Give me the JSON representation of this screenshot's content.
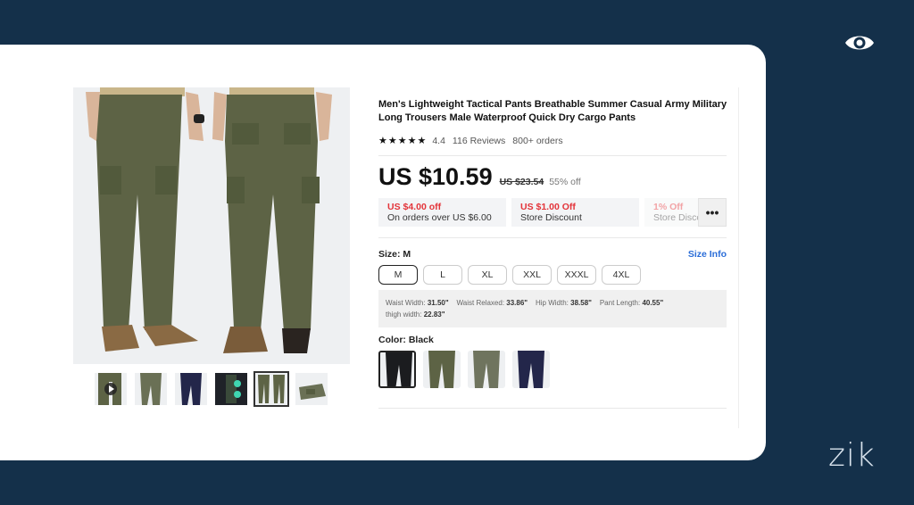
{
  "product": {
    "title": "Men's Lightweight Tactical Pants Breathable Summer Casual Army Military Long Trousers Male Waterproof Quick Dry Cargo Pants",
    "rating": "4.4",
    "reviews": "116 Reviews",
    "orders": "800+ orders",
    "price": "US $10.59",
    "old_price": "US $23.54",
    "discount": "55% off"
  },
  "coupons": [
    {
      "amount": "US $4.00 off",
      "desc": "On orders over US $6.00"
    },
    {
      "amount": "US $1.00 Off",
      "desc": "Store Discount"
    },
    {
      "amount": "1% Off",
      "desc": "Store Discount"
    }
  ],
  "more_label": "•••",
  "size": {
    "label": "Size: M",
    "info_link": "Size Info",
    "options": [
      "M",
      "L",
      "XL",
      "XXL",
      "XXXL",
      "4XL"
    ],
    "selected": "M",
    "measure": {
      "waist_width_label": "Waist Width:",
      "waist_width": "31.50\"",
      "waist_relaxed_label": "Waist Relaxed:",
      "waist_relaxed": "33.86\"",
      "hip_width_label": "Hip Width:",
      "hip_width": "38.58\"",
      "pant_length_label": "Pant Length:",
      "pant_length": "40.55\"",
      "thigh_width_label": "thigh width:",
      "thigh_width": "22.83\""
    }
  },
  "color": {
    "label": "Color: Black",
    "selected": "Black"
  },
  "colors": {
    "accent_link": "#2a6dd8",
    "coupon_red": "#e3343a",
    "background": "#14304a",
    "pants_green": "#5d6345",
    "pants_navy": "#23264a",
    "pants_black": "#1b1c1f"
  },
  "brand": "zik"
}
